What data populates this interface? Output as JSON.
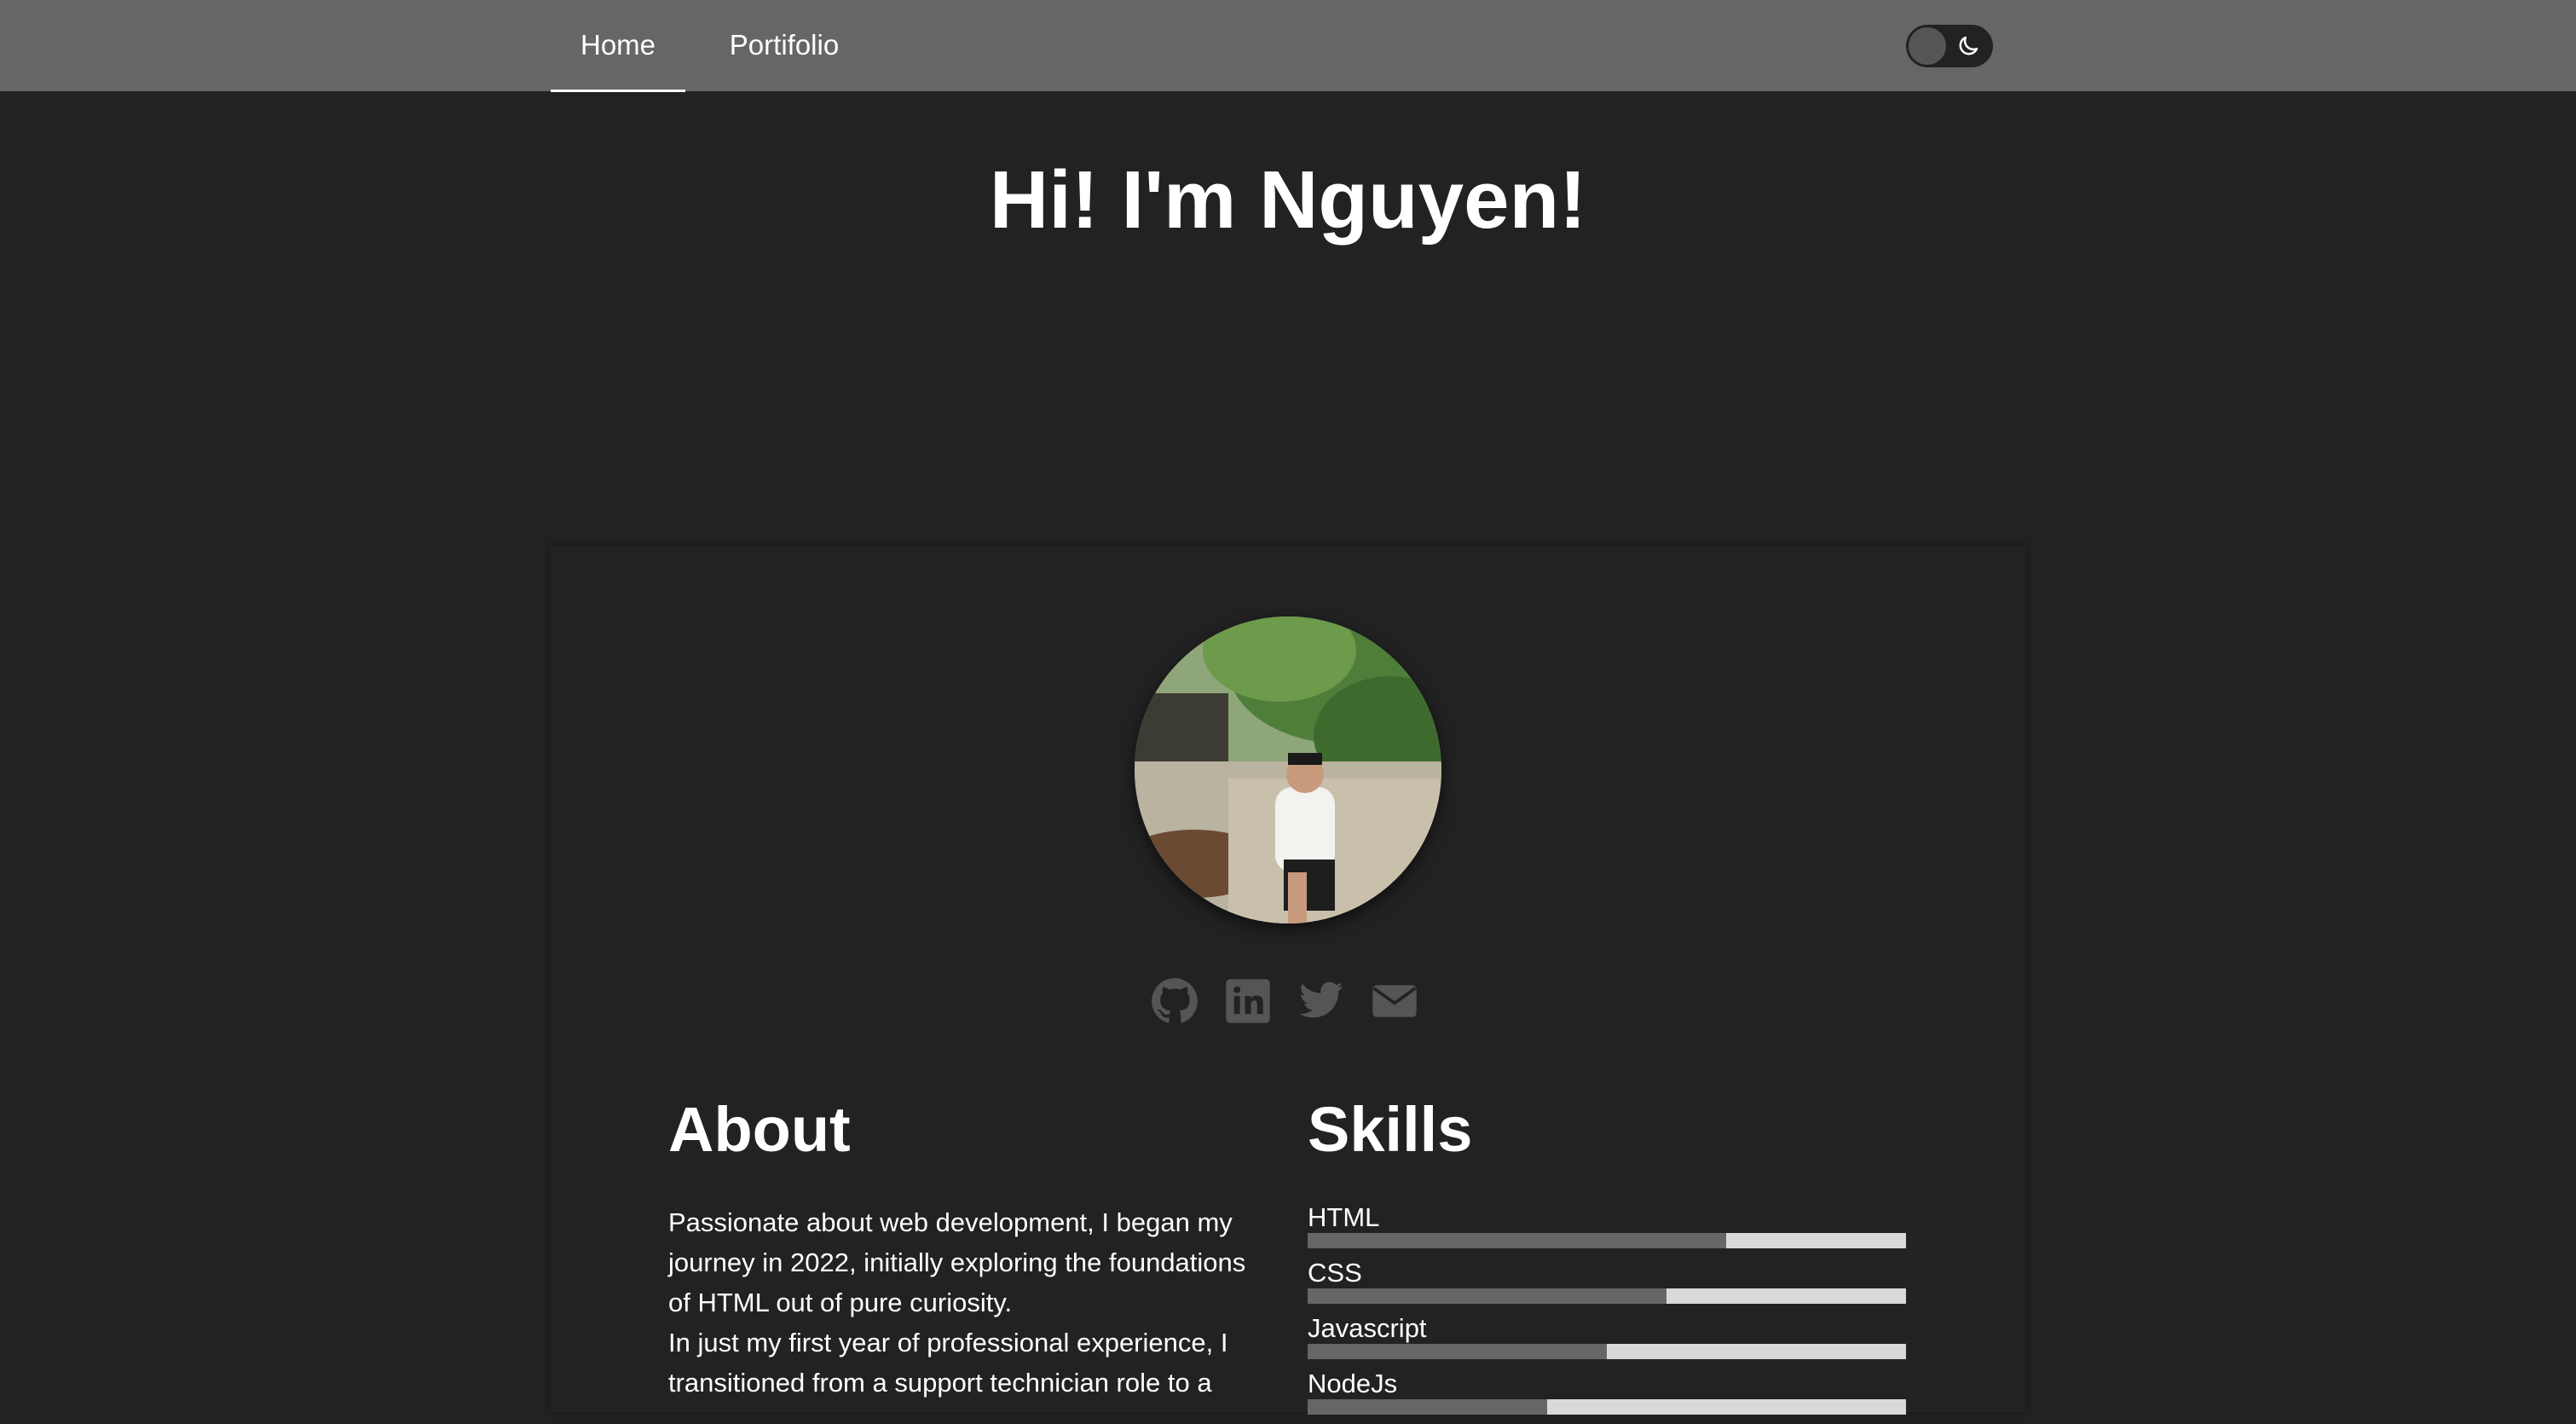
{
  "nav": {
    "tabs": [
      {
        "label": "Home",
        "active": true
      },
      {
        "label": "Portifolio",
        "active": false
      }
    ],
    "theme_toggle": {
      "icon": "moon-icon",
      "state": "dark"
    }
  },
  "hero": {
    "title": "Hi! I'm Nguyen!"
  },
  "profile": {
    "avatar_icon": "profile-photo",
    "socials": [
      {
        "name": "github-icon"
      },
      {
        "name": "linkedin-icon"
      },
      {
        "name": "twitter-icon"
      },
      {
        "name": "email-icon"
      }
    ]
  },
  "about": {
    "title": "About",
    "paragraphs": [
      "Passionate about web development, I began my journey in 2022, initially exploring the foundations of HTML out of pure curiosity.",
      "In just my first year of professional experience, I transitioned from a support technician role to a"
    ]
  },
  "skills": {
    "title": "Skills",
    "items": [
      {
        "name": "HTML",
        "level": 0.7
      },
      {
        "name": "CSS",
        "level": 0.6
      },
      {
        "name": "Javascript",
        "level": 0.5
      },
      {
        "name": "NodeJs",
        "level": 0.4
      }
    ]
  },
  "colors": {
    "background": "#222222",
    "navbar": "#666666",
    "icon": "#555555",
    "bar_track": "#d9d9d9",
    "bar_fill": "#666666"
  }
}
